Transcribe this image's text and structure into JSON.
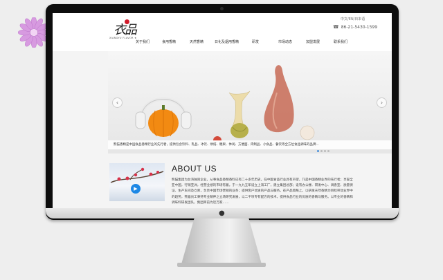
{
  "website": {
    "logo": {
      "mark": "衣品",
      "tagline": "XIANGYU FLAVOR ★"
    },
    "top_links": "中文/EN/日本语",
    "phone": "86-21-5430-1599",
    "nav": [
      "关于我们",
      "食用香精",
      "天然香精",
      "日化及烟用香精",
      "研发",
      "市场动态",
      "加盟发展",
      "联系我们"
    ],
    "hero": {
      "caption": "熊猫香精是中国食品香精行业的先行者，提供包含饮料、乳品、冰饮、烘焙、糖果、休闲、方便面、肉制品、小食品、餐饮等全方位食品调味的品牌..."
    },
    "about": {
      "title": "ABOUT US",
      "paragraph": "熊猫集团为台湾独资企业，从事食品香精香料已有二十多年历史，在中国食品行业具有声望，乃是中国香精业界的先行者；享誉全亚中国，行销亚洲，经营业绩的市场有着。于一九九五年设立上海工厂，建立集团总部；设有办公楼、研发中心、调香室、质量保证、生产车间及仓库，负责中国市场营销的业务；提供客户优质的产品与服务。在产品策略上，以研发天然香精为目标带动业界中的趋势，熊猫员工秉持专业精神之立场研究发展，以二千项专有配方的技术，提供食品行业的优质的香精与服务。以专业的香精和调味料研发团队，集团目前为近万家……"
    }
  }
}
